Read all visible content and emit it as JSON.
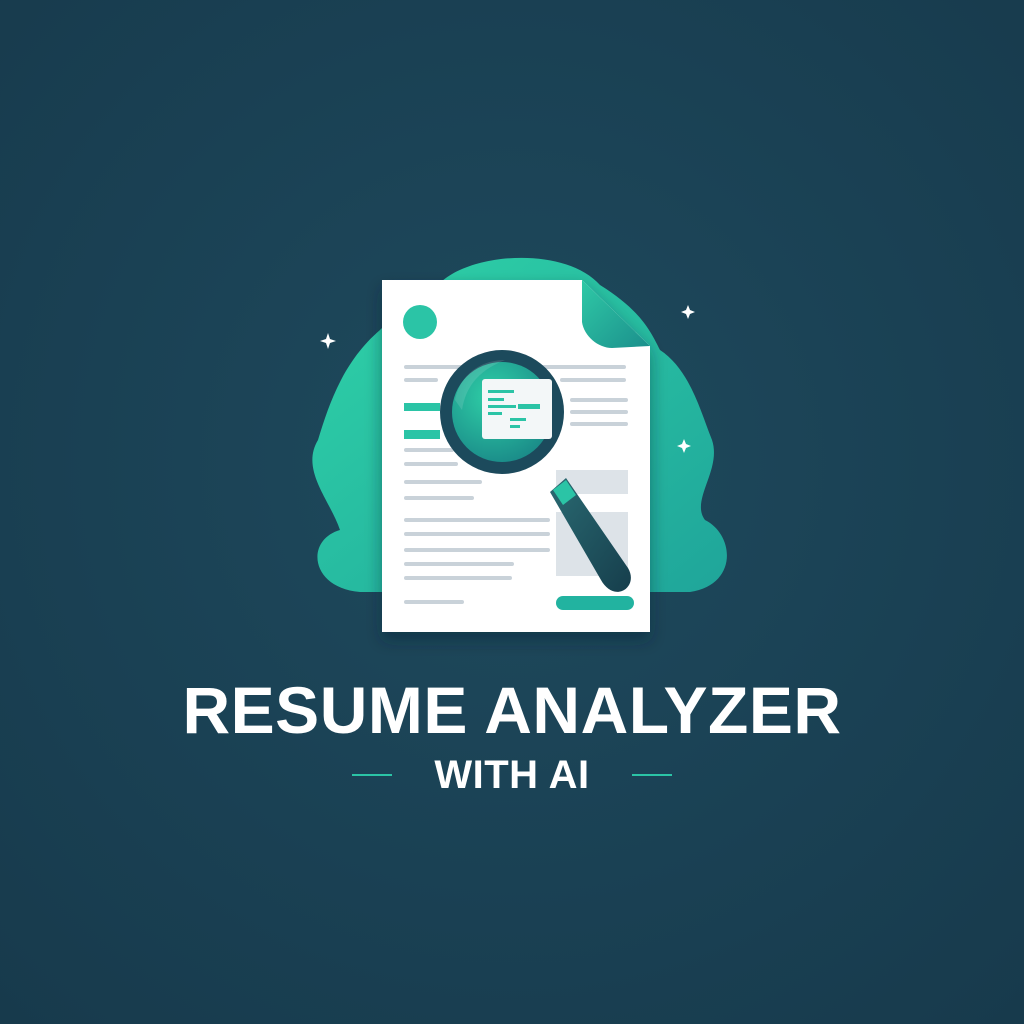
{
  "logo": {
    "title": "RESUME ANALYZER",
    "subtitle": "WITH AI",
    "icon": "resume-magnifier-icon"
  },
  "colors": {
    "background": "#1a4154",
    "accent": "#2bc4a6",
    "accent_dark": "#1e9e96",
    "paper": "#ffffff",
    "text": "#ffffff"
  }
}
